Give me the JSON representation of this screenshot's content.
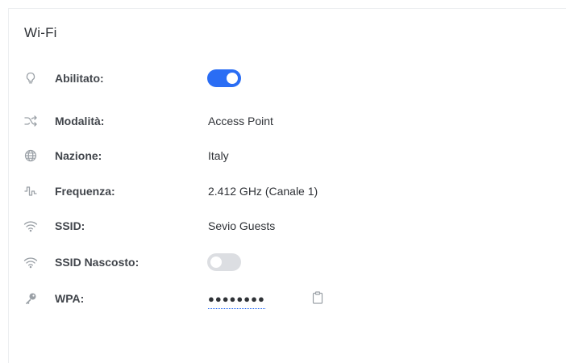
{
  "card": {
    "title": "Wi-Fi"
  },
  "rows": {
    "enabled": {
      "label": "Abilitato:",
      "icon": "lightbulb-icon",
      "state": "on"
    },
    "mode": {
      "label": "Modalità:",
      "icon": "shuffle-icon",
      "value": "Access Point"
    },
    "country": {
      "label": "Nazione:",
      "icon": "globe-icon",
      "value": "Italy"
    },
    "frequency": {
      "label": "Frequenza:",
      "icon": "pulse-wave-icon",
      "value": "2.412 GHz (Canale 1)"
    },
    "ssid": {
      "label": "SSID:",
      "icon": "wifi-icon",
      "value": "Sevio Guests"
    },
    "hidden_ssid": {
      "label": "SSID Nascosto:",
      "icon": "wifi-icon",
      "state": "off"
    },
    "wpa": {
      "label": "WPA:",
      "icon": "key-icon",
      "value": "●●●●●●●●"
    }
  },
  "colors": {
    "accent": "#2a6df4",
    "toggle_off": "#dcdee2",
    "icon": "#9aa0a6",
    "label": "#41454b"
  }
}
